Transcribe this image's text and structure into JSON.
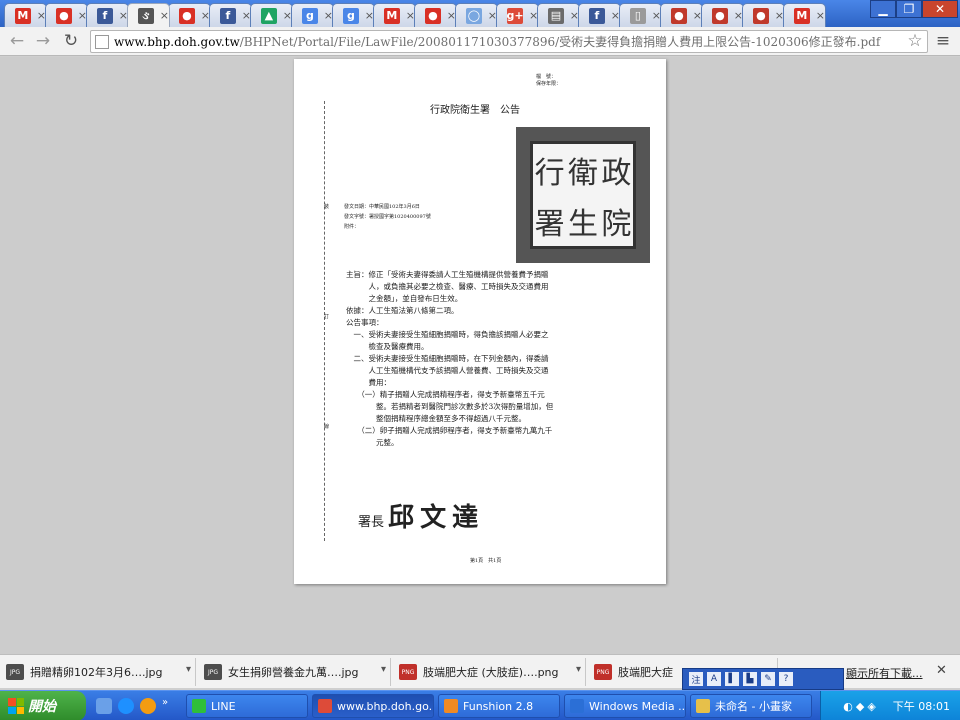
{
  "browser": {
    "tabs": [
      {
        "icon": "gmail-icon",
        "glyph": "M",
        "badge": "2",
        "color": "#d93025"
      },
      {
        "icon": "red-pin-icon",
        "glyph": "●",
        "color": "#d93025"
      },
      {
        "icon": "facebook-icon",
        "glyph": "f",
        "color": "#3b5998"
      },
      {
        "icon": "page-icon",
        "glyph": "ઙ",
        "color": "#555555",
        "active": true
      },
      {
        "icon": "red-pin-icon",
        "glyph": "●",
        "color": "#d93025"
      },
      {
        "icon": "facebook-icon",
        "glyph": "f",
        "color": "#3b5998"
      },
      {
        "icon": "google-drive-icon",
        "glyph": "▲",
        "color": "#1fa463"
      },
      {
        "icon": "google-icon",
        "glyph": "g",
        "color": "#4a86e8"
      },
      {
        "icon": "google-icon",
        "glyph": "g",
        "color": "#4a86e8"
      },
      {
        "icon": "gmail-icon",
        "glyph": "M",
        "badge": "2",
        "color": "#d93025"
      },
      {
        "icon": "red-pin-icon",
        "glyph": "●",
        "color": "#d93025"
      },
      {
        "icon": "circle-icon",
        "glyph": "◯",
        "color": "#7aa7e0"
      },
      {
        "icon": "google-plus-icon",
        "glyph": "g+",
        "color": "#dd4b39"
      },
      {
        "icon": "web-icon",
        "glyph": "▤",
        "color": "#6b6b6b"
      },
      {
        "icon": "facebook-icon",
        "glyph": "f",
        "color": "#3b5998"
      },
      {
        "icon": "blank-page-icon",
        "glyph": "▯",
        "color": "#9a9a9a"
      },
      {
        "icon": "fruit-icon",
        "glyph": "●",
        "color": "#c0392b"
      },
      {
        "icon": "fruit-icon",
        "glyph": "●",
        "color": "#c0392b"
      },
      {
        "icon": "fruit-icon",
        "glyph": "●",
        "color": "#c0392b"
      },
      {
        "icon": "gmail-icon",
        "glyph": "M",
        "badge": "2",
        "color": "#d93025"
      }
    ],
    "address": {
      "host": "www.bhp.doh.gov.tw",
      "path": "/BHPNet/Portal/File/LawFile/200801171030377896/受術夫妻得負擔捐贈人費用上限公告-1020306修正發布.pdf"
    }
  },
  "document": {
    "header_right": [
      "檔　號：",
      "保存年限："
    ],
    "title": "行政院衛生署　公告",
    "margin_marks": [
      "裝",
      "訂",
      "線"
    ],
    "meta": [
      "發文日期：中華民國102年3月6日",
      "發文字號：署授國字第1020400097號",
      "附件："
    ],
    "seal_chars": [
      "院",
      "衛",
      "政",
      "署",
      "生",
      "行"
    ],
    "paragraphs": [
      "主旨：修正「受術夫妻得委請人工生殖機構提供營養費予捐贈",
      "　　　人，或負擔其必要之檢查、醫療、工時損失及交通費用",
      "　　　之金額」，並自發布日生效。",
      "依據：人工生殖法第八條第二項。",
      "公告事項：",
      "　一、受術夫妻接受生殖細胞捐贈時，得負擔該捐贈人必要之",
      "　　　檢查及醫療費用。",
      "　二、受術夫妻接受生殖細胞捐贈時，在下列金額內，得委請",
      "　　　人工生殖機構代支予該捐贈人營養費、工時損失及交通",
      "　　　費用：",
      "　　（一）精子捐贈人完成捐精程序者，得支予新臺幣五千元",
      "　　　　整。若捐精者到醫院門診次數多於3次得酌量增加，但",
      "　　　　整個捐精程序總金額至多不得超過八千元整。",
      "　　（二）卵子捐贈人完成捐卵程序者，得支予新臺幣九萬九千",
      "　　　　元整。"
    ],
    "signature_title": "署長",
    "signature_name": "邱文達",
    "page_footer": "第1頁　共1頁"
  },
  "downloads": {
    "items": [
      {
        "name": "捐贈精卵102年3月6….jpg",
        "type": "JPG"
      },
      {
        "name": "女生捐卵營養金九萬….jpg",
        "type": "JPG"
      },
      {
        "name": "肢端肥大症 (大肢症)….png",
        "type": "PNG"
      },
      {
        "name": "肢端肥大症 ",
        "type": "PNG"
      }
    ],
    "show_all": "顯示所有下載...",
    "close": "✕"
  },
  "ime_toolbar": [
    "注",
    "A",
    "▌",
    "▙",
    "✎",
    "?"
  ],
  "taskbar": {
    "start_label": "開始",
    "tasks": [
      {
        "label": "LINE",
        "color": "#2fbf3a"
      },
      {
        "label": "www.bhp.doh.go...",
        "color": "#dd4b39"
      },
      {
        "label": "Funshion 2.8",
        "color": "#f08a24"
      },
      {
        "label": "Windows Media ...",
        "color": "#2b6fd6"
      },
      {
        "label": "未命名 - 小畫家",
        "color": "#e6c04a"
      }
    ],
    "clock": "下午 08:01"
  }
}
